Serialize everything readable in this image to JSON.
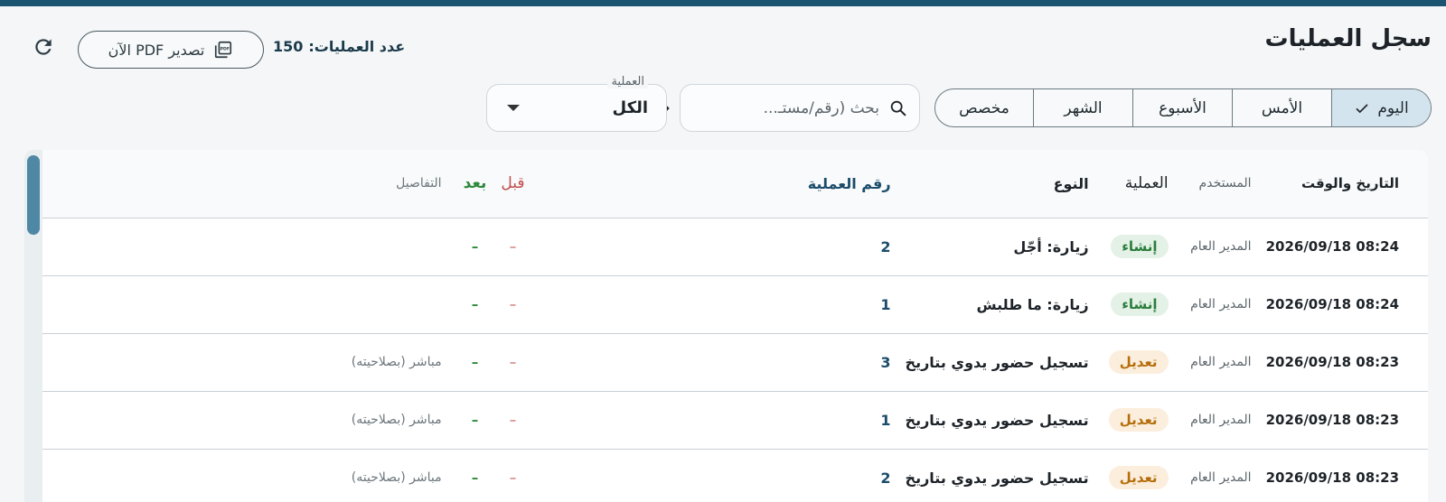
{
  "header": {
    "title": "سجل العمليات",
    "ops_count_label": "عدد العمليات:",
    "ops_count_value": "150",
    "export_label": "تصدير PDF الآن"
  },
  "date_range": {
    "options": [
      "اليوم",
      "الأمس",
      "الأسبوع",
      "الشهر",
      "مخصص"
    ],
    "selected": "اليوم"
  },
  "search": {
    "placeholder": "بحث (رقم/مستـ..."
  },
  "op_filter": {
    "label": "العملية",
    "value": "الكل"
  },
  "table": {
    "columns": [
      "التاريخ والوقت",
      "المستخدم",
      "العملية",
      "النوع",
      "رقم العملية",
      "قبل",
      "بعد",
      "التفاصيل"
    ],
    "rows": [
      {
        "datetime": "2026/09/18 08:24",
        "user": "المدير العام",
        "op": "إنشاء",
        "op_kind": "create",
        "type": "زيارة: أجّل",
        "num": "2",
        "before": "–",
        "after": "–",
        "details": ""
      },
      {
        "datetime": "2026/09/18 08:24",
        "user": "المدير العام",
        "op": "إنشاء",
        "op_kind": "create",
        "type": "زيارة: ما طلبش",
        "num": "1",
        "before": "–",
        "after": "–",
        "details": ""
      },
      {
        "datetime": "2026/09/18 08:23",
        "user": "المدير العام",
        "op": "تعديل",
        "op_kind": "edit",
        "type": "تسجيل حضور يدوي بتاريخ",
        "num": "3",
        "before": "–",
        "after": "–",
        "details": "مباشر (بصلاحيته)"
      },
      {
        "datetime": "2026/09/18 08:23",
        "user": "المدير العام",
        "op": "تعديل",
        "op_kind": "edit",
        "type": "تسجيل حضور يدوي بتاريخ",
        "num": "1",
        "before": "–",
        "after": "–",
        "details": "مباشر (بصلاحيته)"
      },
      {
        "datetime": "2026/09/18 08:23",
        "user": "المدير العام",
        "op": "تعديل",
        "op_kind": "edit",
        "type": "تسجيل حضور يدوي بتاريخ",
        "num": "2",
        "before": "–",
        "after": "–",
        "details": "مباشر (بصلاحيته)"
      }
    ]
  },
  "colors": {
    "top_stripe": "#1b5470",
    "badge_create_bg": "#e3f1e6",
    "badge_create_text": "#2a7d3c",
    "badge_edit_bg": "#fbeedd",
    "badge_edit_text": "#b66e0c",
    "scroll_thumb": "#4f88a4"
  },
  "icons": [
    "refresh-icon",
    "pdf-icon",
    "check-icon",
    "search-icon",
    "arrow-right-icon",
    "caret-down-icon"
  ]
}
